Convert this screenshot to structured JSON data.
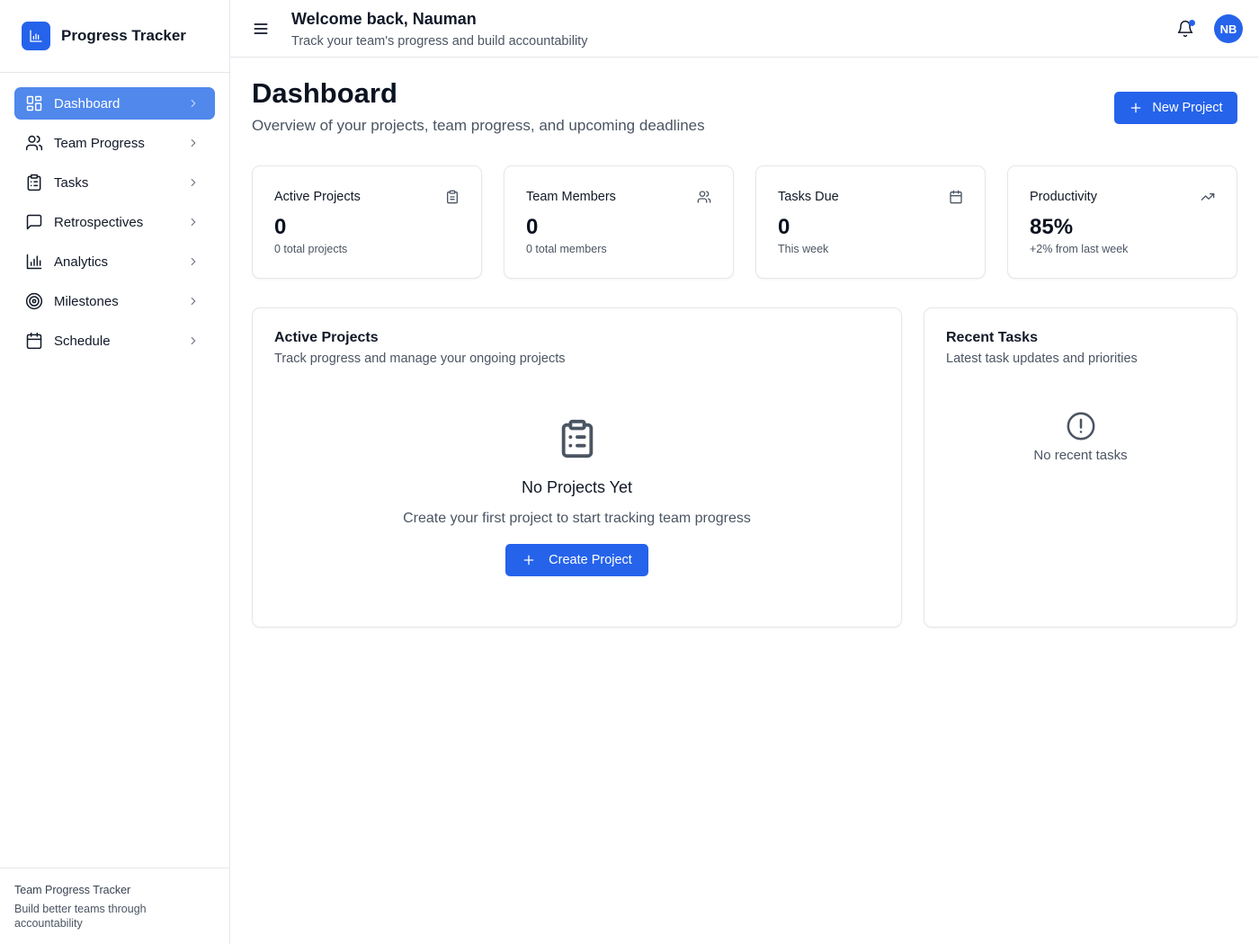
{
  "app": {
    "name": "Progress Tracker",
    "logo_icon": "bar-chart-icon",
    "accent": "#2563eb"
  },
  "sidebar": {
    "items": [
      {
        "label": "Dashboard",
        "icon": "layout-grid-icon",
        "active": true
      },
      {
        "label": "Team Progress",
        "icon": "users-icon",
        "active": false
      },
      {
        "label": "Tasks",
        "icon": "clipboard-list-icon",
        "active": false
      },
      {
        "label": "Retrospectives",
        "icon": "message-square-icon",
        "active": false
      },
      {
        "label": "Analytics",
        "icon": "bar-chart-icon",
        "active": false
      },
      {
        "label": "Milestones",
        "icon": "target-icon",
        "active": false
      },
      {
        "label": "Schedule",
        "icon": "calendar-icon",
        "active": false
      }
    ],
    "footer": {
      "title": "Team Progress Tracker",
      "subtitle": "Build better teams through accountability"
    }
  },
  "header": {
    "welcome": "Welcome back, Nauman",
    "subtitle": "Track your team's progress and build accountability",
    "avatar_initials": "NB"
  },
  "main": {
    "title": "Dashboard",
    "subtitle": "Overview of your projects, team progress, and upcoming deadlines",
    "new_project_label": "New Project"
  },
  "stats": [
    {
      "title": "Active Projects",
      "value": "0",
      "sub": "0 total projects",
      "icon": "clipboard-icon"
    },
    {
      "title": "Team Members",
      "value": "0",
      "sub": "0 total members",
      "icon": "users-icon"
    },
    {
      "title": "Tasks Due",
      "value": "0",
      "sub": "This week",
      "icon": "calendar-icon"
    },
    {
      "title": "Productivity",
      "value": "85%",
      "sub": "+2% from last week",
      "icon": "trending-up-icon"
    }
  ],
  "projects_card": {
    "title": "Active Projects",
    "subtitle": "Track progress and manage your ongoing projects",
    "empty_title": "No Projects Yet",
    "empty_text": "Create your first project to start tracking team progress",
    "create_label": "Create Project"
  },
  "tasks_card": {
    "title": "Recent Tasks",
    "subtitle": "Latest task updates and priorities",
    "empty_text": "No recent tasks"
  }
}
